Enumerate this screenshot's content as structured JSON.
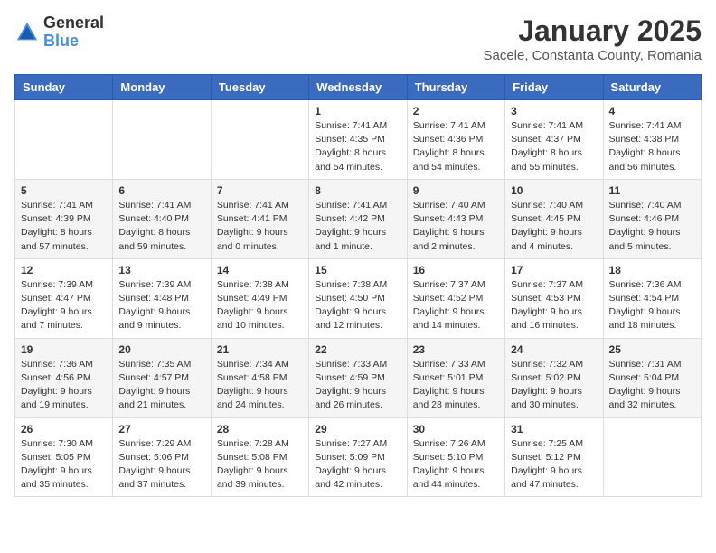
{
  "header": {
    "logo_general": "General",
    "logo_blue": "Blue",
    "title": "January 2025",
    "location": "Sacele, Constanta County, Romania"
  },
  "weekdays": [
    "Sunday",
    "Monday",
    "Tuesday",
    "Wednesday",
    "Thursday",
    "Friday",
    "Saturday"
  ],
  "weeks": [
    [
      {
        "day": "",
        "info": ""
      },
      {
        "day": "",
        "info": ""
      },
      {
        "day": "",
        "info": ""
      },
      {
        "day": "1",
        "info": "Sunrise: 7:41 AM\nSunset: 4:35 PM\nDaylight: 8 hours\nand 54 minutes."
      },
      {
        "day": "2",
        "info": "Sunrise: 7:41 AM\nSunset: 4:36 PM\nDaylight: 8 hours\nand 54 minutes."
      },
      {
        "day": "3",
        "info": "Sunrise: 7:41 AM\nSunset: 4:37 PM\nDaylight: 8 hours\nand 55 minutes."
      },
      {
        "day": "4",
        "info": "Sunrise: 7:41 AM\nSunset: 4:38 PM\nDaylight: 8 hours\nand 56 minutes."
      }
    ],
    [
      {
        "day": "5",
        "info": "Sunrise: 7:41 AM\nSunset: 4:39 PM\nDaylight: 8 hours\nand 57 minutes."
      },
      {
        "day": "6",
        "info": "Sunrise: 7:41 AM\nSunset: 4:40 PM\nDaylight: 8 hours\nand 59 minutes."
      },
      {
        "day": "7",
        "info": "Sunrise: 7:41 AM\nSunset: 4:41 PM\nDaylight: 9 hours\nand 0 minutes."
      },
      {
        "day": "8",
        "info": "Sunrise: 7:41 AM\nSunset: 4:42 PM\nDaylight: 9 hours\nand 1 minute."
      },
      {
        "day": "9",
        "info": "Sunrise: 7:40 AM\nSunset: 4:43 PM\nDaylight: 9 hours\nand 2 minutes."
      },
      {
        "day": "10",
        "info": "Sunrise: 7:40 AM\nSunset: 4:45 PM\nDaylight: 9 hours\nand 4 minutes."
      },
      {
        "day": "11",
        "info": "Sunrise: 7:40 AM\nSunset: 4:46 PM\nDaylight: 9 hours\nand 5 minutes."
      }
    ],
    [
      {
        "day": "12",
        "info": "Sunrise: 7:39 AM\nSunset: 4:47 PM\nDaylight: 9 hours\nand 7 minutes."
      },
      {
        "day": "13",
        "info": "Sunrise: 7:39 AM\nSunset: 4:48 PM\nDaylight: 9 hours\nand 9 minutes."
      },
      {
        "day": "14",
        "info": "Sunrise: 7:38 AM\nSunset: 4:49 PM\nDaylight: 9 hours\nand 10 minutes."
      },
      {
        "day": "15",
        "info": "Sunrise: 7:38 AM\nSunset: 4:50 PM\nDaylight: 9 hours\nand 12 minutes."
      },
      {
        "day": "16",
        "info": "Sunrise: 7:37 AM\nSunset: 4:52 PM\nDaylight: 9 hours\nand 14 minutes."
      },
      {
        "day": "17",
        "info": "Sunrise: 7:37 AM\nSunset: 4:53 PM\nDaylight: 9 hours\nand 16 minutes."
      },
      {
        "day": "18",
        "info": "Sunrise: 7:36 AM\nSunset: 4:54 PM\nDaylight: 9 hours\nand 18 minutes."
      }
    ],
    [
      {
        "day": "19",
        "info": "Sunrise: 7:36 AM\nSunset: 4:56 PM\nDaylight: 9 hours\nand 19 minutes."
      },
      {
        "day": "20",
        "info": "Sunrise: 7:35 AM\nSunset: 4:57 PM\nDaylight: 9 hours\nand 21 minutes."
      },
      {
        "day": "21",
        "info": "Sunrise: 7:34 AM\nSunset: 4:58 PM\nDaylight: 9 hours\nand 24 minutes."
      },
      {
        "day": "22",
        "info": "Sunrise: 7:33 AM\nSunset: 4:59 PM\nDaylight: 9 hours\nand 26 minutes."
      },
      {
        "day": "23",
        "info": "Sunrise: 7:33 AM\nSunset: 5:01 PM\nDaylight: 9 hours\nand 28 minutes."
      },
      {
        "day": "24",
        "info": "Sunrise: 7:32 AM\nSunset: 5:02 PM\nDaylight: 9 hours\nand 30 minutes."
      },
      {
        "day": "25",
        "info": "Sunrise: 7:31 AM\nSunset: 5:04 PM\nDaylight: 9 hours\nand 32 minutes."
      }
    ],
    [
      {
        "day": "26",
        "info": "Sunrise: 7:30 AM\nSunset: 5:05 PM\nDaylight: 9 hours\nand 35 minutes."
      },
      {
        "day": "27",
        "info": "Sunrise: 7:29 AM\nSunset: 5:06 PM\nDaylight: 9 hours\nand 37 minutes."
      },
      {
        "day": "28",
        "info": "Sunrise: 7:28 AM\nSunset: 5:08 PM\nDaylight: 9 hours\nand 39 minutes."
      },
      {
        "day": "29",
        "info": "Sunrise: 7:27 AM\nSunset: 5:09 PM\nDaylight: 9 hours\nand 42 minutes."
      },
      {
        "day": "30",
        "info": "Sunrise: 7:26 AM\nSunset: 5:10 PM\nDaylight: 9 hours\nand 44 minutes."
      },
      {
        "day": "31",
        "info": "Sunrise: 7:25 AM\nSunset: 5:12 PM\nDaylight: 9 hours\nand 47 minutes."
      },
      {
        "day": "",
        "info": ""
      }
    ]
  ]
}
